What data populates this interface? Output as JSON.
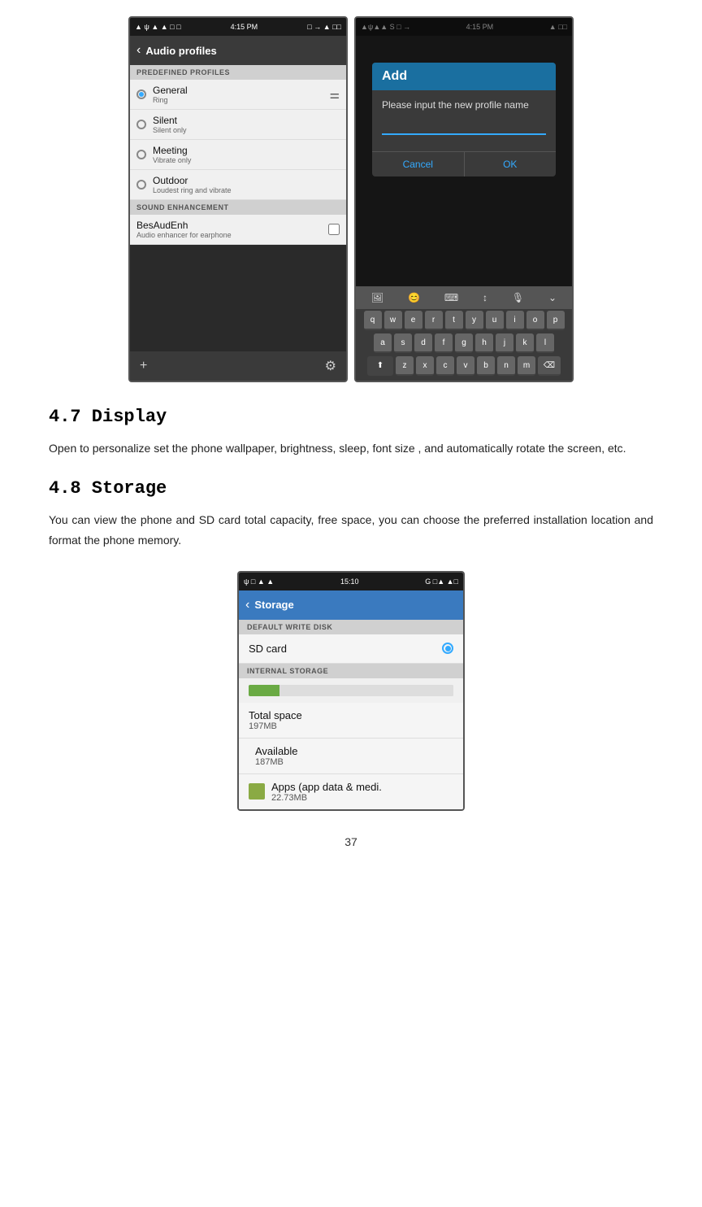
{
  "page": {
    "number": "37"
  },
  "screenshot_left": {
    "status_bar": {
      "left_icons": "▲ ψ ▲ ▲ □ □",
      "time": "4:15 PM",
      "right_icons": "□ → ▲ □□"
    },
    "app_bar": {
      "back_icon": "‹",
      "title": "Audio profiles"
    },
    "predefined_header": "PREDEFINED PROFILES",
    "profiles": [
      {
        "name": "General",
        "desc": "Ring",
        "selected": true
      },
      {
        "name": "Silent",
        "desc": "Silent only",
        "selected": false
      },
      {
        "name": "Meeting",
        "desc": "Vibrate only",
        "selected": false
      },
      {
        "name": "Outdoor",
        "desc": "Loudest ring and vibrate",
        "selected": false
      }
    ],
    "sound_header": "SOUND ENHANCEMENT",
    "sound_item": {
      "name": "BesAudEnh",
      "desc": "Audio enhancer for earphone"
    },
    "bottom_add": "+",
    "bottom_settings": "⚙"
  },
  "screenshot_right": {
    "status_bar": {
      "left_icons": "▲ψ▲▲ S □ →",
      "time": "4:15 PM",
      "right_icons": "▲ □□"
    },
    "dialog": {
      "title": "Add",
      "prompt": "Please input the new profile name",
      "cancel_label": "Cancel",
      "ok_label": "OK"
    },
    "keyboard": {
      "toolbar_icons": [
        "🎤",
        "😊",
        "⌨",
        "⬆",
        "🎙",
        "⌄"
      ],
      "rows": [
        [
          "q",
          "w",
          "e",
          "r",
          "t",
          "y",
          "u",
          "i",
          "o",
          "p"
        ],
        [
          "a",
          "s",
          "d",
          "f",
          "g",
          "h",
          "j",
          "k",
          "l"
        ],
        [
          "⬆",
          "z",
          "x",
          "c",
          "v",
          "b",
          "n",
          "m",
          "⌫"
        ]
      ]
    }
  },
  "section_47": {
    "title": "4.7 Display",
    "body": "Open to personalize set the phone wallpaper, brightness, sleep, font size , and automatically rotate the screen, etc."
  },
  "section_48": {
    "title": "4.8 Storage",
    "body": "You can view the phone and SD card total capacity, free space, you can choose the preferred installation location and format the phone memory."
  },
  "storage_screenshot": {
    "status_bar": {
      "left_icons": "ψ □ ▲ ▲",
      "time": "15:10",
      "right_icons": "G □▲ ▲□"
    },
    "app_bar": {
      "back_icon": "‹",
      "title": "Storage"
    },
    "default_write_header": "DEFAULT WRITE DISK",
    "sd_card_label": "SD card",
    "internal_header": "INTERNAL STORAGE",
    "progress_fill_percent": 15,
    "total_space_label": "Total space",
    "total_space_value": "197MB",
    "available_label": "Available",
    "available_value": "187MB",
    "apps_label": "Apps (app data & medi.",
    "apps_value": "22.73MB"
  }
}
